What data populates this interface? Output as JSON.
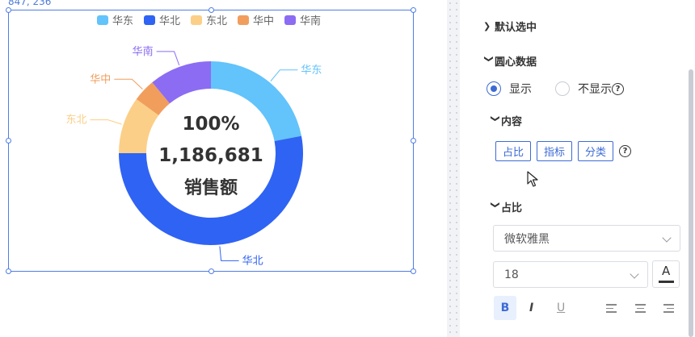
{
  "canvas": {
    "coordinate_readout": "847, 236"
  },
  "chart_data": {
    "type": "pie",
    "donut": true,
    "categories": [
      "华东",
      "华北",
      "东北",
      "华中",
      "华南"
    ],
    "values": [
      22,
      53,
      10,
      4,
      11
    ],
    "colors": [
      "#63c3fb",
      "#2f63f3",
      "#fbcf87",
      "#f19e5d",
      "#8b6cf3"
    ],
    "legend_position": "top",
    "center_text": {
      "percent": "100%",
      "value": "1,186,681",
      "metric": "销售额"
    }
  },
  "panel": {
    "default_selected": "默认选中",
    "center_data": "圆心数据",
    "show_label": "显示",
    "hide_label": "不显示",
    "content": "内容",
    "content_buttons": [
      "占比",
      "指标",
      "分类"
    ],
    "proportion": "占比",
    "font_family": "微软雅黑",
    "font_size": "18",
    "help_glyph": "?",
    "bold_glyph": "B",
    "italic_glyph": "I",
    "underline_glyph": "U",
    "font_color_glyph": "A"
  }
}
